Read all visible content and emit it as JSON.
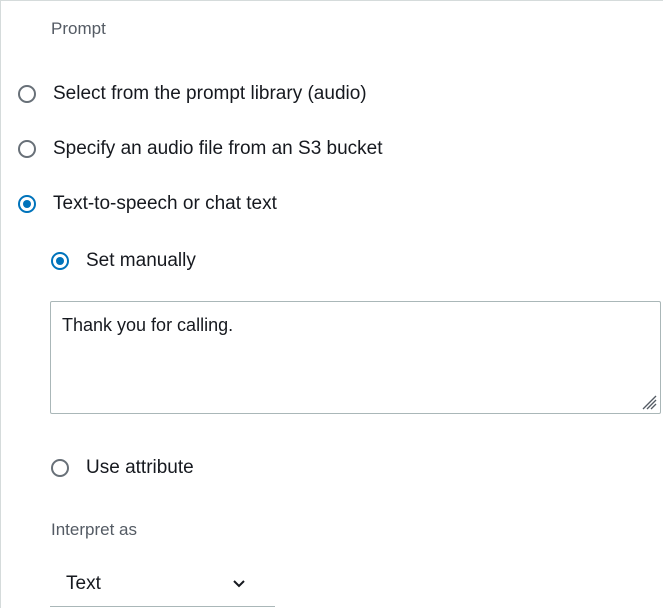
{
  "section": {
    "label": "Prompt"
  },
  "options": {
    "library": "Select from the prompt library (audio)",
    "s3": "Specify an audio file from an S3 bucket",
    "tts": "Text-to-speech or chat text"
  },
  "tts_mode": {
    "manual": "Set manually",
    "attribute": "Use attribute"
  },
  "text_input": {
    "value": "Thank you for calling."
  },
  "interpret": {
    "label": "Interpret as",
    "selected": "Text"
  },
  "colors": {
    "accent": "#0073bb",
    "border": "#aab7b8",
    "secondary_text": "#545b64"
  }
}
